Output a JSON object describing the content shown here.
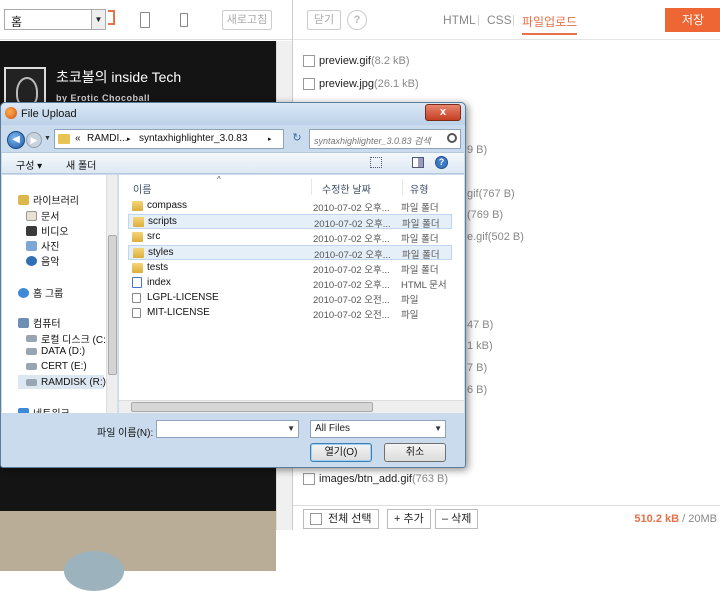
{
  "editor": {
    "font_select": "홈",
    "refresh_label": "새로고침",
    "blog_title": "초코볼의 inside Tech",
    "blog_subtitle": "by Erotic Chocoball"
  },
  "header": {
    "close_label": "닫기",
    "help_label": "?",
    "tabs": [
      {
        "label": "HTML"
      },
      {
        "label": "CSS"
      },
      {
        "label": "파일업로드"
      }
    ],
    "save_label": "저장"
  },
  "files": [
    {
      "name": "preview.gif",
      "size": "(8.2 kB)"
    },
    {
      "name": "preview.jpg",
      "size": "(26.1 kB)"
    },
    {
      "name": "images/btn_add.gif",
      "size": "(763 B)"
    }
  ],
  "file_fragments": [
    "9 B)",
    "gif(767 B)",
    "(769 B)",
    "e.gif(502 B)",
    "47 B)",
    "1 kB)",
    "7 B)",
    "6 B)"
  ],
  "footer": {
    "select_all": "전체 선택",
    "add": "+ 추가",
    "delete": "– 삭제",
    "used": "510.2 kB",
    "limit": "/ 20MB"
  },
  "dialog": {
    "title": "File Upload",
    "close_label": "x",
    "breadcrumb": [
      "«",
      "RAMDI...",
      "▸",
      "syntaxhighlighter_3.0.83",
      "▸"
    ],
    "search_placeholder": "syntaxhighlighter_3.0.83 검색",
    "organize": "구성 ▾",
    "new_folder": "새 폴더",
    "nav_items": [
      {
        "label": "라이브러리"
      },
      {
        "label": "문서"
      },
      {
        "label": "비디오"
      },
      {
        "label": "사진"
      },
      {
        "label": "음악"
      },
      {
        "label": "홈 그룹"
      },
      {
        "label": "컴퓨터"
      },
      {
        "label": "로컬 디스크 (C:)"
      },
      {
        "label": "DATA (D:)"
      },
      {
        "label": "CERT (E:)"
      },
      {
        "label": "RAMDISK (R:)"
      },
      {
        "label": "네트워크"
      }
    ],
    "columns": {
      "name": "이름",
      "date": "수정한 날짜",
      "type": "유형"
    },
    "rows": [
      {
        "name": "compass",
        "date": "2010-07-02 오후...",
        "type": "파일 폴더",
        "kind": "folder"
      },
      {
        "name": "scripts",
        "date": "2010-07-02 오후...",
        "type": "파일 폴더",
        "kind": "folder"
      },
      {
        "name": "src",
        "date": "2010-07-02 오후...",
        "type": "파일 폴더",
        "kind": "folder"
      },
      {
        "name": "styles",
        "date": "2010-07-02 오후...",
        "type": "파일 폴더",
        "kind": "folder"
      },
      {
        "name": "tests",
        "date": "2010-07-02 오후...",
        "type": "파일 폴더",
        "kind": "folder"
      },
      {
        "name": "index",
        "date": "2010-07-02 오후...",
        "type": "HTML 문서",
        "kind": "html"
      },
      {
        "name": "LGPL-LICENSE",
        "date": "2010-07-02 오전...",
        "type": "파일",
        "kind": "file"
      },
      {
        "name": "MIT-LICENSE",
        "date": "2010-07-02 오전...",
        "type": "파일",
        "kind": "file"
      }
    ],
    "filename_label": "파일 이름(N):",
    "filename_value": "",
    "filter_value": "All Files",
    "open_label": "열기(O)",
    "cancel_label": "취소"
  },
  "colors": {
    "accent": "#ee6633",
    "dialog_frame": "#c9dbed"
  }
}
